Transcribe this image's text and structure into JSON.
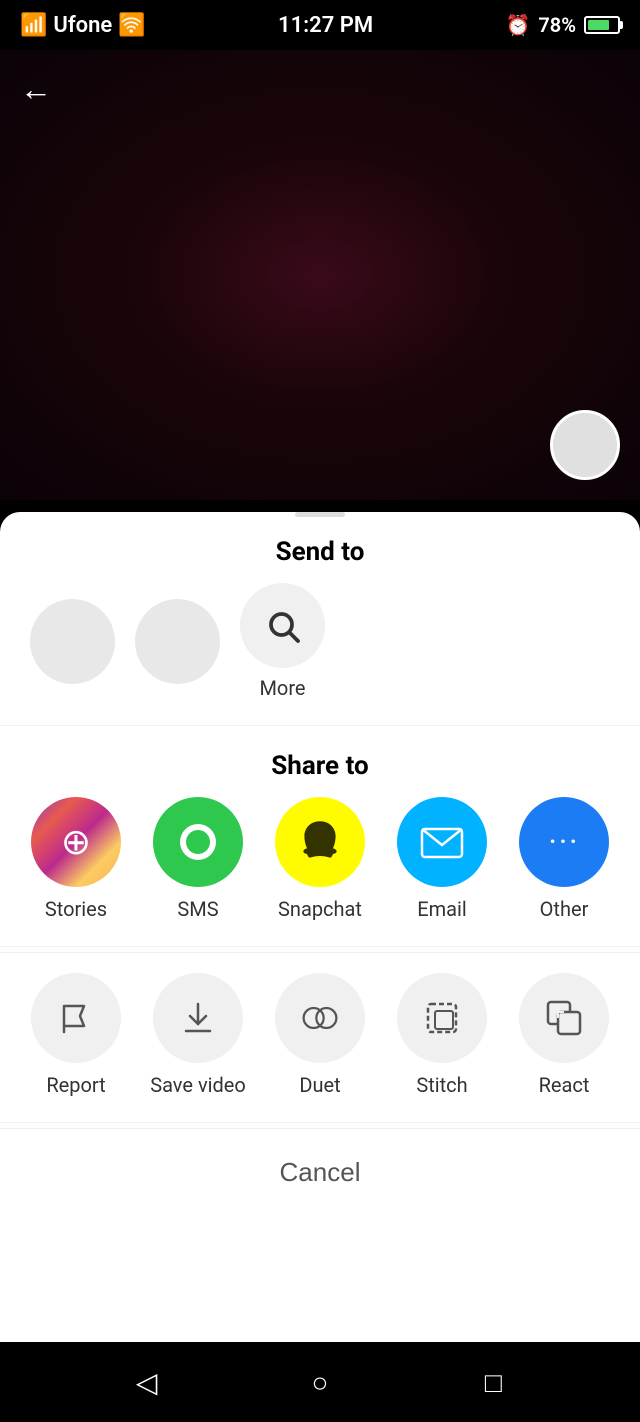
{
  "statusBar": {
    "carrier": "Ufone",
    "time": "11:27 PM",
    "battery": "78%"
  },
  "backButton": "←",
  "sendTo": {
    "title": "Send to",
    "moreLabel": "More"
  },
  "shareTo": {
    "title": "Share to",
    "items": [
      {
        "id": "stories",
        "label": "Stories",
        "type": "stories"
      },
      {
        "id": "sms",
        "label": "SMS",
        "type": "sms"
      },
      {
        "id": "snapchat",
        "label": "Snapchat",
        "type": "snapchat"
      },
      {
        "id": "email",
        "label": "Email",
        "type": "email"
      },
      {
        "id": "other",
        "label": "Other",
        "type": "other"
      }
    ]
  },
  "actions": [
    {
      "id": "report",
      "label": "Report"
    },
    {
      "id": "save-video",
      "label": "Save video"
    },
    {
      "id": "duet",
      "label": "Duet"
    },
    {
      "id": "stitch",
      "label": "Stitch"
    },
    {
      "id": "react",
      "label": "React"
    }
  ],
  "cancelLabel": "Cancel",
  "nav": {
    "back": "◁",
    "home": "○",
    "recent": "□"
  }
}
